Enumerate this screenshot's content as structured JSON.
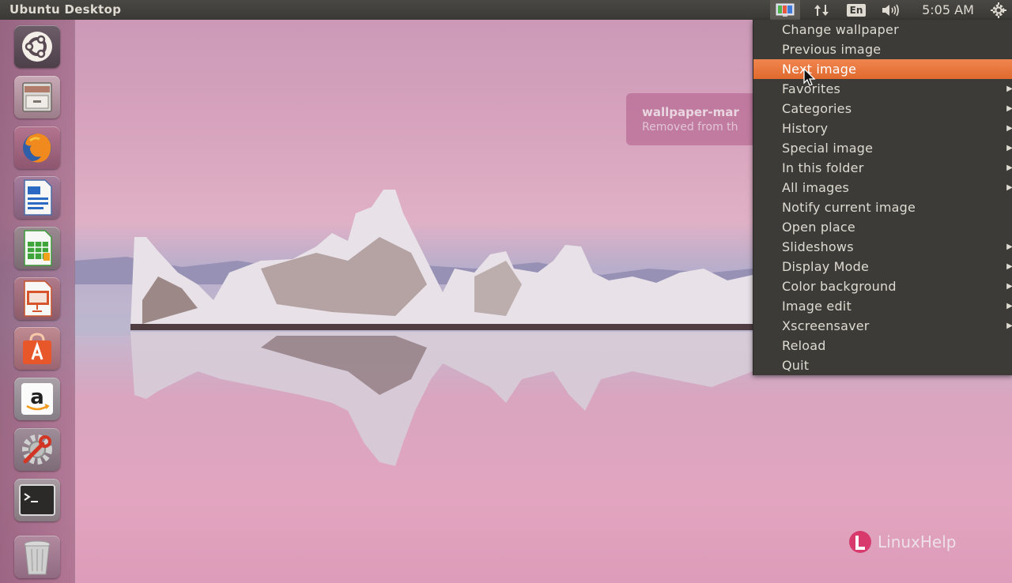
{
  "panel": {
    "title": "Ubuntu Desktop",
    "keyboard_layout": "En",
    "clock": "5:05 AM",
    "indicators": [
      "wallpaper-indicator-icon",
      "network-icon",
      "keyboard-icon",
      "sound-icon",
      "clock",
      "gear-icon"
    ]
  },
  "launcher": {
    "items": [
      {
        "name": "dash-home",
        "icon": "ubuntu-logo-icon"
      },
      {
        "name": "files",
        "icon": "file-cabinet-icon"
      },
      {
        "name": "firefox",
        "icon": "firefox-icon"
      },
      {
        "name": "libreoffice-writer",
        "icon": "writer-icon"
      },
      {
        "name": "libreoffice-calc",
        "icon": "calc-icon"
      },
      {
        "name": "libreoffice-impress",
        "icon": "impress-icon"
      },
      {
        "name": "software-center",
        "icon": "shopping-bag-icon"
      },
      {
        "name": "amazon",
        "icon": "amazon-icon"
      },
      {
        "name": "system-settings",
        "icon": "settings-wrench-icon"
      },
      {
        "name": "terminal",
        "icon": "terminal-icon"
      },
      {
        "name": "trash",
        "icon": "trash-icon"
      }
    ]
  },
  "notification": {
    "title": "wallpaper-mar",
    "body": "Removed from th"
  },
  "menu": {
    "items": [
      {
        "label": "Change wallpaper",
        "submenu": false
      },
      {
        "label": "Previous image",
        "submenu": false
      },
      {
        "label": "Next image",
        "submenu": false,
        "active": true
      },
      {
        "label": "Favorites",
        "submenu": true
      },
      {
        "label": "Categories",
        "submenu": true
      },
      {
        "label": "History",
        "submenu": true
      },
      {
        "label": "Special image",
        "submenu": true
      },
      {
        "label": "In this folder",
        "submenu": true
      },
      {
        "label": "All images",
        "submenu": true
      },
      {
        "label": "Notify current image",
        "submenu": false
      },
      {
        "label": "Open place",
        "submenu": false
      },
      {
        "label": "Slideshows",
        "submenu": true
      },
      {
        "label": "Display Mode",
        "submenu": true
      },
      {
        "label": "Color background",
        "submenu": true
      },
      {
        "label": "Image edit",
        "submenu": true
      },
      {
        "label": "Xscreensaver",
        "submenu": true
      },
      {
        "label": "Reload",
        "submenu": false
      },
      {
        "label": "Quit",
        "submenu": false
      }
    ],
    "arrow_glyph": "▶"
  },
  "watermark": {
    "text": "LinuxHelp"
  },
  "colors": {
    "panel_bg": "#3c3b37",
    "menu_bg": "#3c3b37",
    "menu_active": "#e9733a",
    "menu_text": "#dfdbd2"
  }
}
